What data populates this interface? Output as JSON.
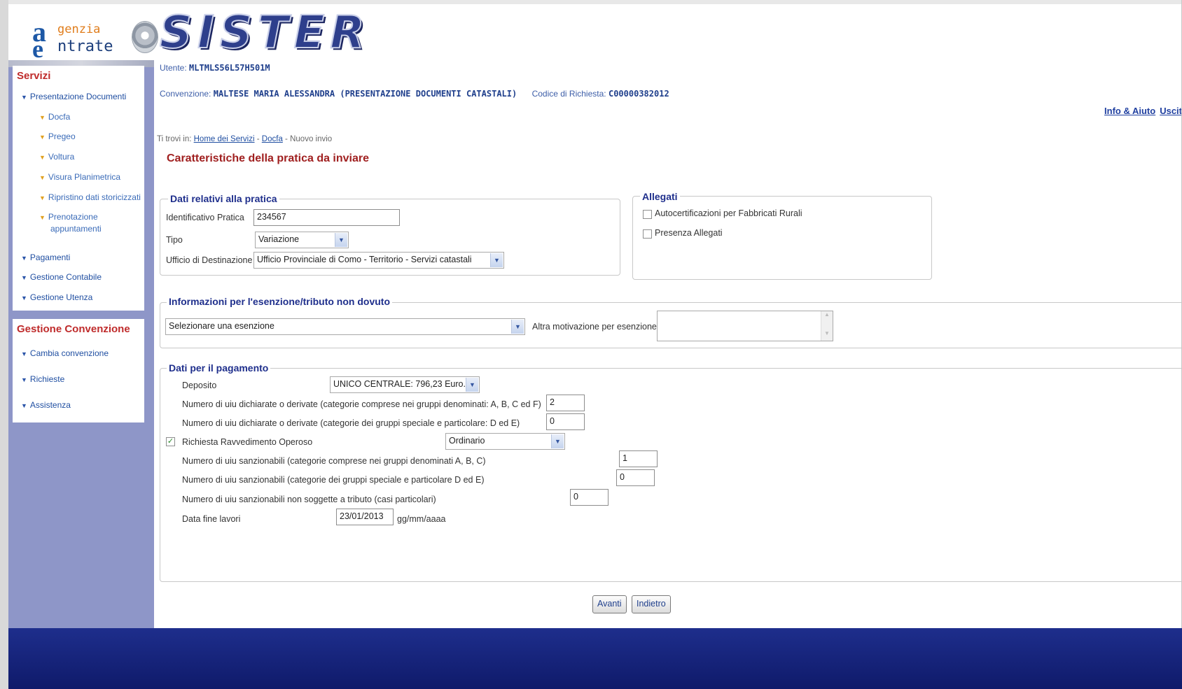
{
  "header": {
    "logo_genzia": "genzia",
    "logo_ntrate": "ntrate",
    "app_name": "SISTER"
  },
  "sidebar": {
    "servizi_title": "Servizi",
    "items": [
      {
        "label": "Presentazione Documenti"
      },
      {
        "label": "Docfa"
      },
      {
        "label": "Pregeo"
      },
      {
        "label": "Voltura"
      },
      {
        "label": "Visura Planimetrica"
      },
      {
        "label": "Ripristino dati storicizzati"
      },
      {
        "label": "Prenotazione"
      },
      {
        "label": "appuntamenti"
      },
      {
        "label": "Pagamenti"
      },
      {
        "label": "Gestione Contabile"
      },
      {
        "label": "Gestione Utenza"
      }
    ],
    "gestione_title": "Gestione Convenzione",
    "gestione_items": [
      {
        "label": "Cambia convenzione"
      },
      {
        "label": "Richieste"
      },
      {
        "label": "Assistenza"
      }
    ]
  },
  "user": {
    "utente_label": "Utente:",
    "utente_value": "MLTMLS56L57H501M",
    "convenzione_label": "Convenzione:",
    "convenzione_value": "MALTESE MARIA ALESSANDRA (PRESENTAZIONE DOCUMENTI CATASTALI)",
    "codice_label": "Codice di Richiesta:",
    "codice_value": "C00000382012"
  },
  "links": {
    "info": "Info & Aiuto",
    "uscita": "Uscit"
  },
  "breadcrumb": {
    "prefix": "Ti trovi in:",
    "home": "Home dei Servizi",
    "sep1": "-",
    "docfa": "Docfa",
    "sep2": "-",
    "current": "Nuovo invio"
  },
  "page_title": "Caratteristiche della pratica da inviare",
  "pratica": {
    "legend": "Dati relativi alla pratica",
    "identificativo_label": "Identificativo Pratica",
    "identificativo_value": "234567",
    "tipo_label": "Tipo",
    "tipo_value": "Variazione",
    "ufficio_label": "Ufficio di Destinazione",
    "ufficio_value": "Ufficio Provinciale di Como - Territorio - Servizi catastali"
  },
  "allegati": {
    "legend": "Allegati",
    "autocert_label": "Autocertificazioni per Fabbricati Rurali",
    "presenza_label": "Presenza Allegati"
  },
  "esenzione": {
    "legend": "Informazioni per l'esenzione/tributo non dovuto",
    "select_value": "Selezionare una esenzione",
    "altra_label": "Altra motivazione per esenzione"
  },
  "pagamento": {
    "legend": "Dati per il pagamento",
    "deposito_label": "Deposito",
    "deposito_value": "UNICO CENTRALE: 796,23 Euro.",
    "uiu_abc_label": "Numero di uiu dichiarate o derivate (categorie comprese nei gruppi denominati: A, B, C ed F)",
    "uiu_abc_value": "2",
    "uiu_de_label": "Numero di uiu dichiarate o derivate (categorie dei gruppi speciale e particolare: D ed E)",
    "uiu_de_value": "0",
    "ravvedimento_label": "Richiesta Ravvedimento Operoso",
    "ravvedimento_value": "Ordinario",
    "sanz_abc_label": "Numero di uiu sanzionabili (categorie comprese nei gruppi denominati A, B, C)",
    "sanz_abc_value": "1",
    "sanz_de_label": "Numero di uiu sanzionabili (categorie dei gruppi speciale e particolare D ed E)",
    "sanz_de_value": "0",
    "sanz_non_label": "Numero di uiu sanzionabili non soggette a tributo (casi particolari)",
    "sanz_non_value": "0",
    "data_label": "Data fine lavori",
    "data_value": "23/01/2013",
    "data_hint": "gg/mm/aaaa"
  },
  "buttons": {
    "avanti": "Avanti",
    "indietro": "Indietro"
  },
  "colors": {
    "brand_blue": "#1f2f8c",
    "title_red": "#a02020",
    "sidebar_bg": "#8e96c8",
    "footer_blue": "#1e2e8c"
  }
}
